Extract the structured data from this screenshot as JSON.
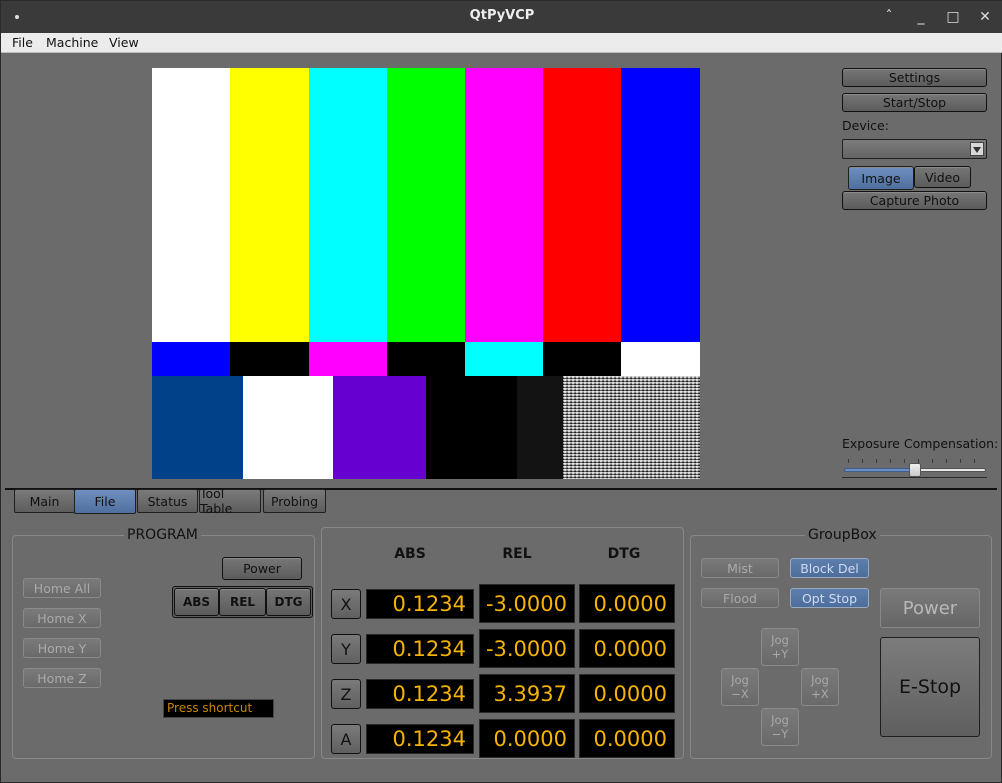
{
  "window": {
    "title": "QtPyVCP",
    "controls": [
      "^",
      "_",
      "▢",
      "✕"
    ]
  },
  "menu": [
    "File",
    "Machine",
    "View"
  ],
  "camera": {
    "settings_label": "Settings",
    "start_stop_label": "Start/Stop",
    "device_label": "Device:",
    "device_value": "",
    "image_label": "Image",
    "video_label": "Video",
    "capture_label": "Capture Photo",
    "exposure_label": "Exposure Compensation:",
    "exposure_value": 0.5
  },
  "tabs": [
    {
      "label": "Main",
      "active": false
    },
    {
      "label": "File",
      "active": true
    },
    {
      "label": "Status",
      "active": false
    },
    {
      "label": "Tool Table",
      "active": false
    },
    {
      "label": "Probing",
      "active": false
    }
  ],
  "program": {
    "title": "PROGRAM",
    "power_label": "Power",
    "home": [
      "Home All",
      "Home X",
      "Home Y",
      "Home Z"
    ],
    "dro_modes": [
      "ABS",
      "REL",
      "DTG"
    ],
    "shortcut_placeholder": "Press shortcut"
  },
  "dro": {
    "headers": [
      "ABS",
      "REL",
      "DTG"
    ],
    "rows": [
      {
        "axis": "X",
        "abs": "0.1234",
        "rel": "-3.0000",
        "dtg": "0.0000"
      },
      {
        "axis": "Y",
        "abs": "0.1234",
        "rel": "-3.0000",
        "dtg": "0.0000"
      },
      {
        "axis": "Z",
        "abs": "0.1234",
        "rel": "3.3937",
        "dtg": "0.0000"
      },
      {
        "axis": "A",
        "abs": "0.1234",
        "rel": "0.0000",
        "dtg": "0.0000"
      }
    ]
  },
  "groupbox": {
    "title": "GroupBox",
    "mist_label": "Mist",
    "block_del_label": "Block Del",
    "flood_label": "Flood",
    "opt_stop_label": "Opt Stop",
    "power_label": "Power",
    "estop_label": "E-Stop",
    "jog_plus_y": "Jog +Y",
    "jog_minus_x": "Jog −X",
    "jog_plus_x": "Jog +X",
    "jog_minus_y": "Jog −Y"
  },
  "colors": {
    "accent": "#5c7db0",
    "dro_text": "#f5b400",
    "panel_bg": "#6b6b6b"
  }
}
